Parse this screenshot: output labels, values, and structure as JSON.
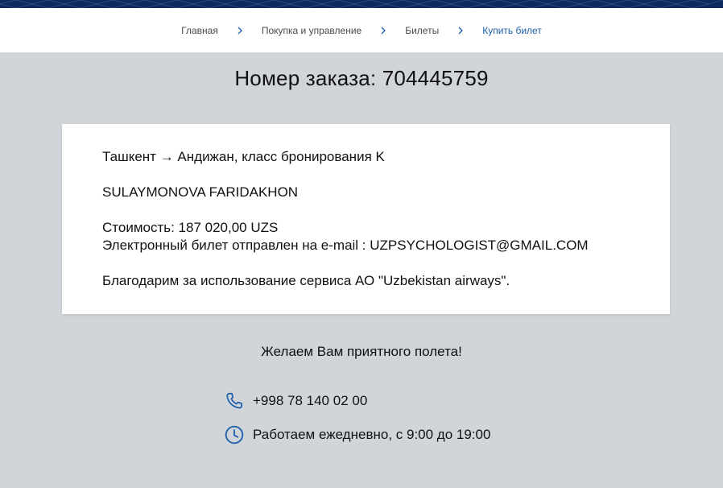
{
  "breadcrumb": {
    "items": [
      {
        "label": "Главная"
      },
      {
        "label": "Покупка и управление"
      },
      {
        "label": "Билеты"
      },
      {
        "label": "Купить билет"
      }
    ]
  },
  "order": {
    "title": "Номер заказа: 704445759"
  },
  "card": {
    "route": "Ташкент → Андижан, класс бронирования K",
    "passenger": "SULAYMONOVA FARIDAKHON",
    "cost": "Стоимость: 187 020,00 UZS",
    "email_notice": "Электронный билет отправлен на e-mail : UZPSYCHOLOGIST@GMAIL.COM",
    "thanks": "Благодарим за использование сервиса АО \"Uzbekistan airways\"."
  },
  "footer": {
    "wish": "Желаем Вам приятного полета!",
    "phone": "+998 78 140 02 00",
    "hours": "Работаем ежедневно, с 9:00 до 19:00"
  },
  "icons": {
    "phone": "phone-icon",
    "clock": "clock-icon",
    "chevron": "chevron-right-icon"
  },
  "colors": {
    "header_strip": "#0d2a5c",
    "accent": "#1c5fa8",
    "page_bg": "#d1d5da",
    "card_bg": "#ffffff"
  }
}
